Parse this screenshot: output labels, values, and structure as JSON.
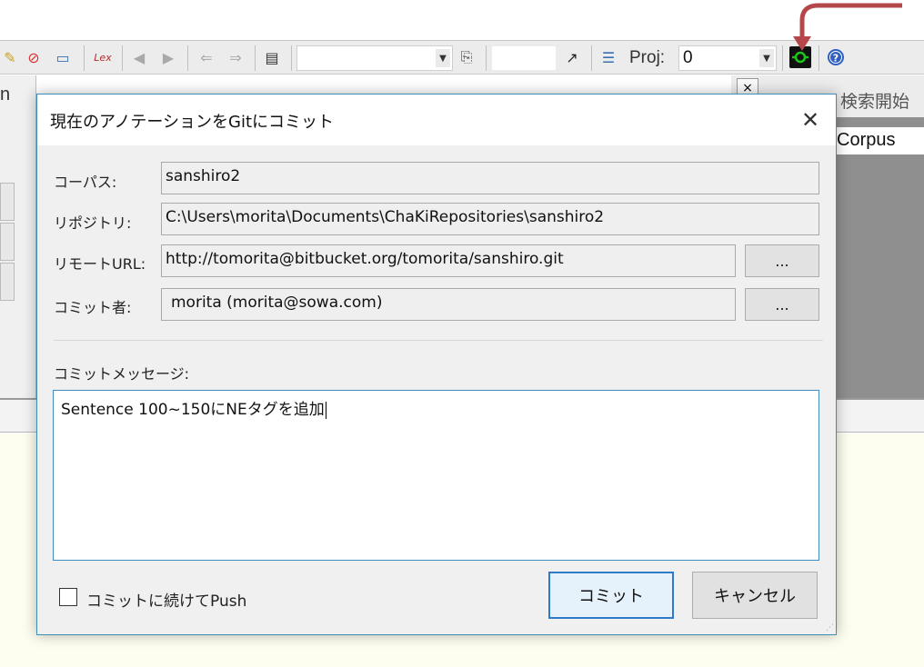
{
  "toolbar": {
    "icons": [
      "edit-icon",
      "stop-icon",
      "window-icon",
      "lex-icon",
      "back-icon",
      "forward-icon",
      "left-arrow-icon",
      "right-arrow-icon",
      "save-icon",
      "dropdown-icon",
      "search-doc-icon",
      "link-arrow-icon",
      "list-icon",
      "git-icon",
      "help-icon"
    ],
    "lex_label": "Lex",
    "proj_label": "Proj:",
    "proj_value": "0"
  },
  "background": {
    "left_tab_fragment": "n",
    "right_close": "×",
    "right_search_label": "検索開始",
    "right_corpus_label": "Corpus"
  },
  "dialog": {
    "title": "現在のアノテーションをGitにコミット",
    "close": "✕",
    "corpus_label": "コーパス:",
    "corpus_value": "sanshiro2",
    "repository_label": "リポジトリ:",
    "repository_value": "C:\\Users\\morita\\Documents\\ChaKiRepositories\\sanshiro2",
    "remote_url_label": "リモートURL:",
    "remote_url_value": "http://tomorita@bitbucket.org/tomorita/sanshiro.git",
    "committer_label": "コミット者:",
    "committer_value": "morita (morita@sowa.com)",
    "browse_button": "...",
    "message_label": "コミットメッセージ:",
    "message_value": "Sentence 100~150にNEタグを追加",
    "push_checkbox_label": "コミットに続けてPush",
    "push_checked": false,
    "commit_button": "コミット",
    "cancel_button": "キャンセル"
  },
  "colors": {
    "dialog_border": "#3d8fb8",
    "annotation_arrow": "#b5474b",
    "git_icon_green": "#19c819",
    "commit_button_border": "#2f79c9"
  }
}
